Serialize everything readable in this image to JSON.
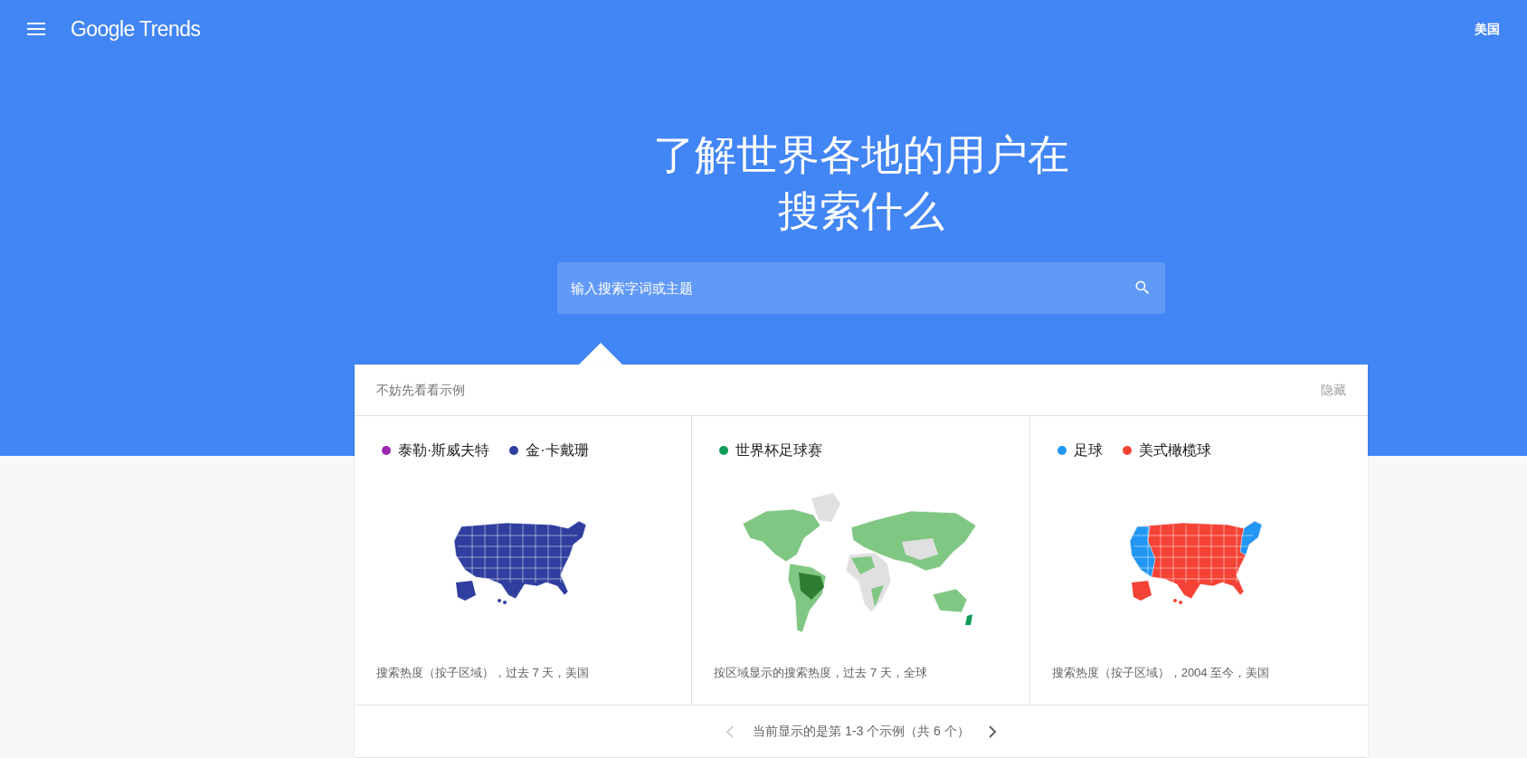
{
  "header": {
    "logo": "Google Trends",
    "region": "美国"
  },
  "hero": {
    "title_lines": [
      "了解世界各地的用户在",
      "搜索什么"
    ]
  },
  "search": {
    "placeholder": "输入搜索字词或主题"
  },
  "examples": {
    "heading": "不妨先看看示例",
    "hide_link": "隐藏",
    "cards": [
      {
        "series": [
          {
            "name": "泰勒·斯威夫特",
            "color": "#9c27b0"
          },
          {
            "name": "金·卡戴珊",
            "color": "#303f9f"
          }
        ],
        "map": {
          "kind": "us",
          "split": false
        },
        "caption": "搜索热度（按子区域），过去 7 天，美国"
      },
      {
        "series": [
          {
            "name": "世界杯足球赛",
            "color": "#0f9d58"
          }
        ],
        "map": {
          "kind": "world",
          "split": false
        },
        "caption": "按区域显示的搜索热度，过去 7 天，全球"
      },
      {
        "series": [
          {
            "name": "足球",
            "color": "#2196f3"
          },
          {
            "name": "美式橄榄球",
            "color": "#f44336"
          }
        ],
        "map": {
          "kind": "us",
          "split": true
        },
        "caption": "搜索热度（按子区域），2004 至今，美国"
      }
    ],
    "pager": {
      "text": "当前显示的是第 1-3 个示例（共 6 个）",
      "prev_disabled": true,
      "next_disabled": false
    }
  }
}
